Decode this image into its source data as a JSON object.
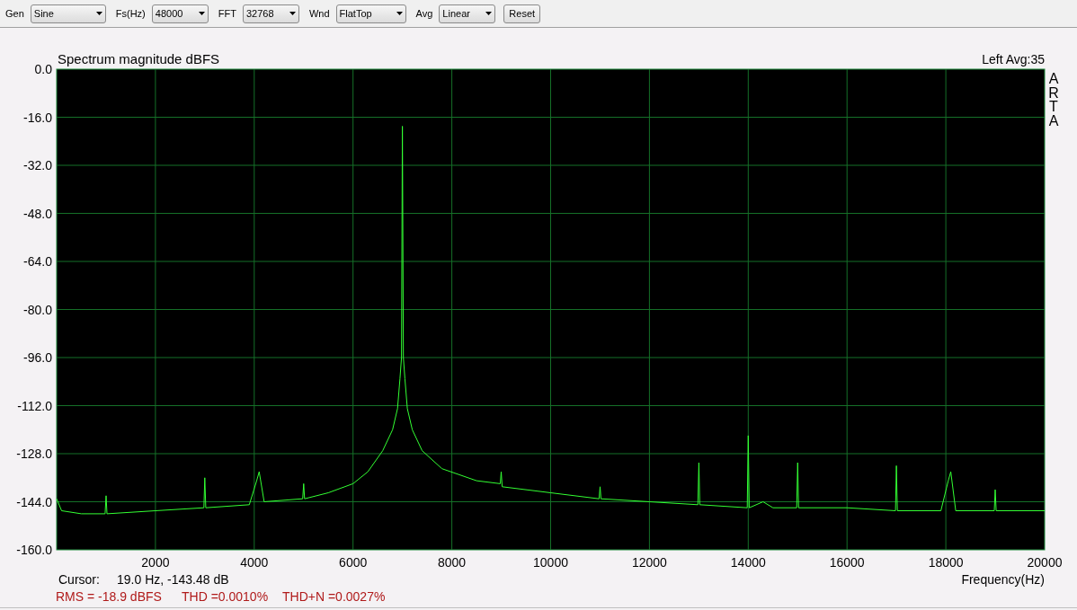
{
  "toolbar": {
    "controls": [
      {
        "kind": "dropdown",
        "label": "Gen",
        "value": "Sine"
      },
      {
        "kind": "dropdown",
        "label": "Fs(Hz)",
        "value": "48000"
      },
      {
        "kind": "dropdown",
        "label": "FFT",
        "value": "32768"
      },
      {
        "kind": "dropdown",
        "label": "Wnd",
        "value": "FlatTop"
      },
      {
        "kind": "dropdown",
        "label": "Avg",
        "value": "Linear"
      },
      {
        "kind": "button",
        "value": "Reset"
      }
    ]
  },
  "chart": {
    "channel_info": "Left  Avg:35",
    "side_label": "ARTA",
    "chart_data": {
      "type": "line",
      "title": "Spectrum magnitude dBFS",
      "xlabel": "Frequency(Hz)",
      "xlim": [
        0,
        20000
      ],
      "ylim": [
        -160,
        0
      ],
      "xticks": [
        2000,
        4000,
        6000,
        8000,
        10000,
        12000,
        14000,
        16000,
        18000,
        20000
      ],
      "yticks": [
        {
          "value": 0,
          "label": "0.0"
        },
        {
          "value": -16,
          "label": "-16.0"
        },
        {
          "value": -32,
          "label": "-32.0"
        },
        {
          "value": -48,
          "label": "-48.0"
        },
        {
          "value": -64,
          "label": "-64.0"
        },
        {
          "value": -80,
          "label": "-80.0"
        },
        {
          "value": -96,
          "label": "-96.0"
        },
        {
          "value": -112,
          "label": "-112.0"
        },
        {
          "value": -128,
          "label": "-128.0"
        },
        {
          "value": -144,
          "label": "-144.0"
        },
        {
          "value": -160,
          "label": "-160.0"
        }
      ],
      "x": [
        0,
        100,
        500,
        980,
        1000,
        1020,
        2000,
        2980,
        3000,
        3020,
        3900,
        4050,
        4100,
        4200,
        4980,
        5000,
        5020,
        5500,
        6000,
        6300,
        6600,
        6800,
        6900,
        6950,
        6980,
        7000,
        7020,
        7050,
        7100,
        7200,
        7400,
        7800,
        8500,
        8980,
        9000,
        9020,
        10000,
        10980,
        11000,
        11020,
        12000,
        12980,
        13000,
        13020,
        13980,
        14000,
        14020,
        14300,
        14500,
        14980,
        15000,
        15020,
        16000,
        16980,
        17000,
        17020,
        17900,
        18050,
        18100,
        18200,
        18980,
        19000,
        19020,
        20000
      ],
      "grid": true,
      "series": [
        {
          "color": "#33ff33",
          "values": [
            -143,
            -147,
            -148,
            -148,
            -142,
            -148,
            -147,
            -146,
            -136,
            -146,
            -145,
            -137,
            -134,
            -144,
            -143,
            -138,
            -143,
            -141,
            -138,
            -134,
            -127,
            -120,
            -113,
            -103,
            -96,
            -19,
            -96,
            -103,
            -113,
            -120,
            -127,
            -133,
            -137,
            -138,
            -134,
            -139,
            -141,
            -143,
            -139,
            -143,
            -144,
            -145,
            -131,
            -145,
            -146,
            -122,
            -146,
            -144,
            -146,
            -146,
            -131,
            -146,
            -146,
            -147,
            -132,
            -147,
            -147,
            -137,
            -134,
            -147,
            -147,
            -140,
            -147,
            -147
          ]
        }
      ]
    },
    "cursor": {
      "label": "Cursor:",
      "value": "19.0 Hz, -143.48 dB"
    },
    "measurements": [
      "RMS =  -18.9 dBFS",
      "THD =0.0010%",
      "THD+N =0.0027%"
    ]
  }
}
